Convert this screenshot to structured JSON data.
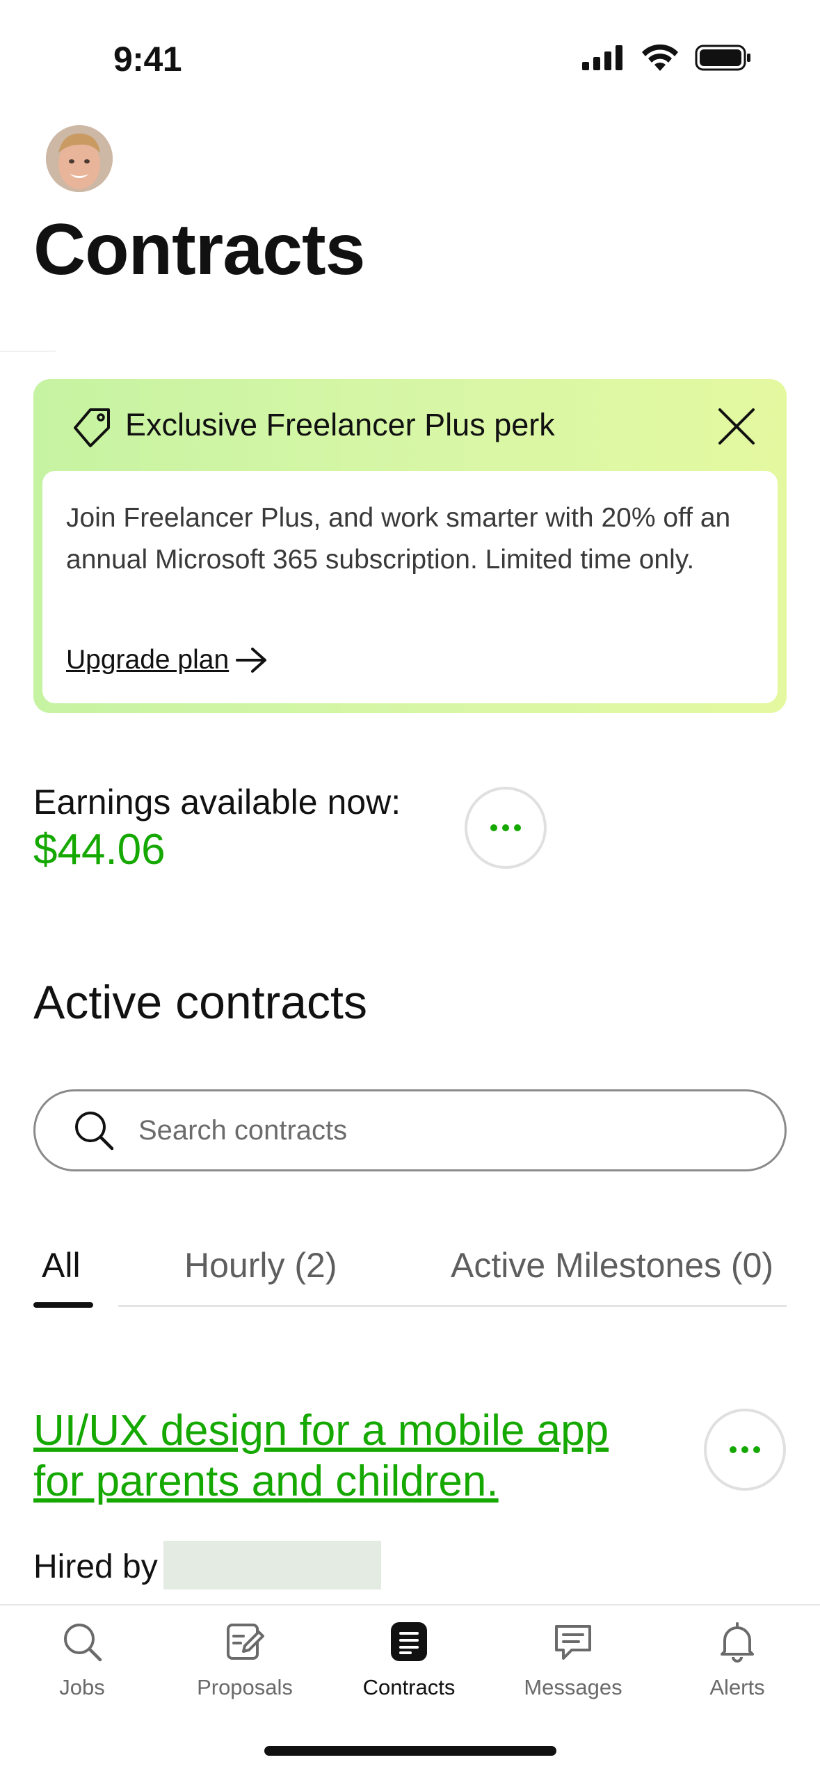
{
  "status_bar": {
    "time": "9:41"
  },
  "header": {
    "title": "Contracts"
  },
  "promo": {
    "title": "Exclusive Freelancer Plus perk",
    "body": "Join Freelancer Plus, and work smarter with 20% off an annual Microsoft 365 subscription. Limited time only.",
    "link_label": "Upgrade plan",
    "background": "#d6f7a7"
  },
  "earnings": {
    "label": "Earnings available now:",
    "amount": "$44.06"
  },
  "active_contracts": {
    "title": "Active contracts",
    "search": {
      "placeholder": "Search contracts"
    },
    "tabs": [
      {
        "label": "All",
        "active": true
      },
      {
        "label": "Hourly (2)",
        "active": false
      },
      {
        "label": "Active Milestones (0)",
        "active": false
      }
    ],
    "contracts": [
      {
        "title": "UI/UX design for a mobile app for parents and children.",
        "hired_by_label": "Hired by"
      }
    ]
  },
  "bottom_nav": {
    "items": [
      {
        "label": "Jobs",
        "icon": "search-icon"
      },
      {
        "label": "Proposals",
        "icon": "proposals-icon"
      },
      {
        "label": "Contracts",
        "icon": "contracts-icon",
        "active": true
      },
      {
        "label": "Messages",
        "icon": "messages-icon"
      },
      {
        "label": "Alerts",
        "icon": "bell-icon"
      }
    ]
  },
  "colors": {
    "accent": "#14a800",
    "text": "#111111",
    "muted": "#6a6a6a"
  }
}
